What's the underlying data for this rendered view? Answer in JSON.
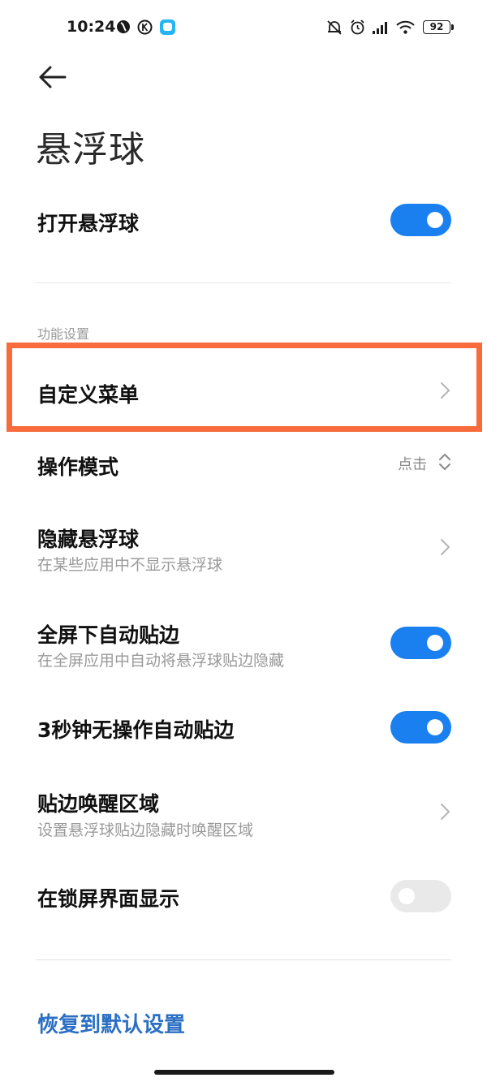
{
  "status_bar": {
    "time": "10:24",
    "battery": "92",
    "icons": [
      "app-icon-1",
      "k-icon",
      "message-app-icon",
      "mute-icon",
      "alarm-icon",
      "signal-icon",
      "wifi-icon",
      "battery-icon"
    ]
  },
  "header": {
    "back_icon": "back-arrow-icon",
    "title": "悬浮球"
  },
  "main_toggle": {
    "label": "打开悬浮球",
    "on": true
  },
  "section": {
    "label": "功能设置"
  },
  "rows": {
    "custom_menu": {
      "title": "自定义菜单"
    },
    "operation_mode": {
      "title": "操作模式",
      "value": "点击"
    },
    "hide_ball": {
      "title": "隐藏悬浮球",
      "subtitle": "在某些应用中不显示悬浮球"
    },
    "fullscreen_edge": {
      "title": "全屏下自动贴边",
      "subtitle": "在全屏应用中自动将悬浮球贴边隐藏",
      "on": true
    },
    "idle_edge": {
      "title": "3秒钟无操作自动贴边",
      "on": true
    },
    "wake_area": {
      "title": "贴边唤醒区域",
      "subtitle": "设置悬浮球贴边隐藏时唤醒区域"
    },
    "lock_screen": {
      "title": "在锁屏界面显示",
      "on": false
    }
  },
  "footer": {
    "restore_label": "恢复到默认设置"
  },
  "colors": {
    "accent": "#1a80f0",
    "highlight": "#f76b3c",
    "link": "#2b6fc4"
  }
}
